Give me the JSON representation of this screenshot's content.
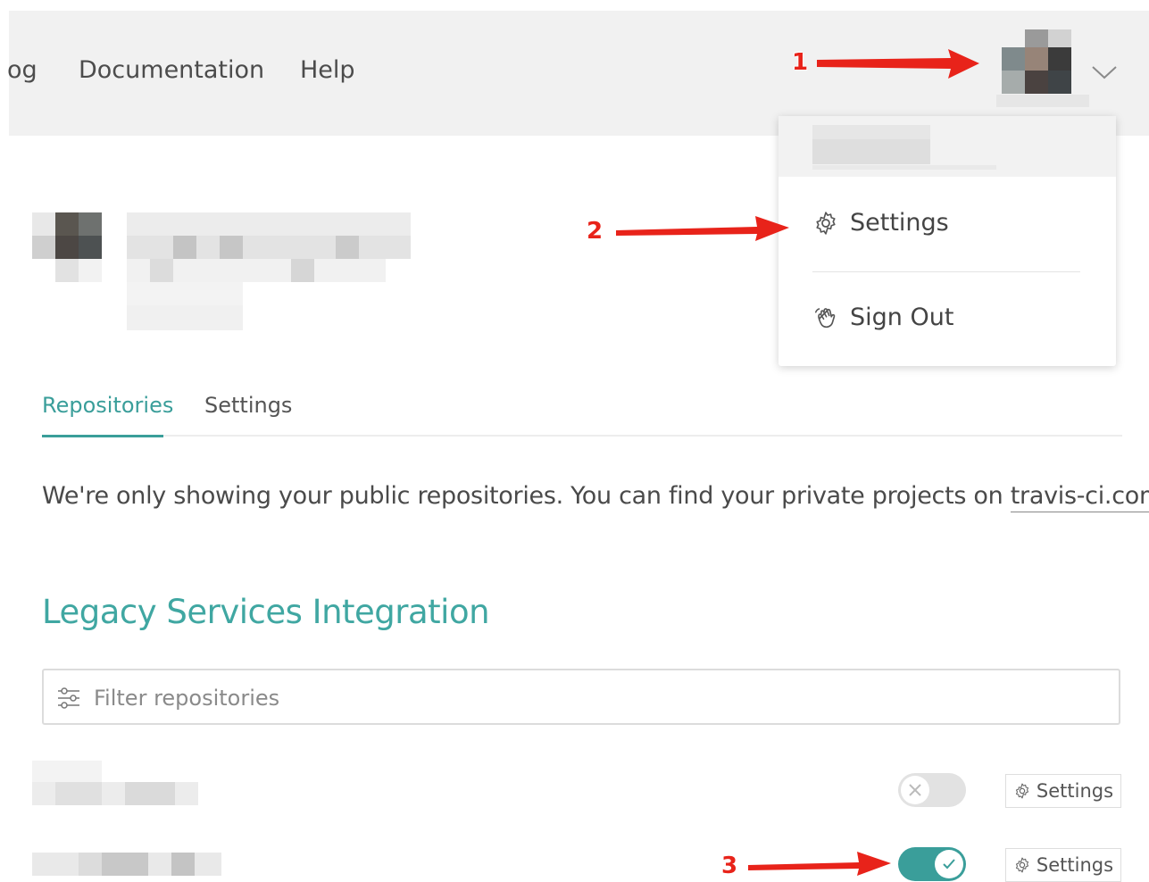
{
  "nav": {
    "items": [
      "og",
      "Documentation",
      "Help"
    ]
  },
  "profile_menu": {
    "settings_label": "Settings",
    "signout_label": "Sign Out"
  },
  "tabs": [
    {
      "label": "Repositories",
      "active": true
    },
    {
      "label": "Settings",
      "active": false
    }
  ],
  "notice": {
    "text": "We're only showing your public repositories. You can find your private projects on",
    "link": "travis-ci.com",
    "suffix": "."
  },
  "section_title": "Legacy Services Integration",
  "filter": {
    "placeholder": "Filter repositories"
  },
  "repos": [
    {
      "enabled": false,
      "settings_label": "Settings"
    },
    {
      "enabled": true,
      "settings_label": "Settings"
    }
  ],
  "annotations": [
    "1",
    "2",
    "3"
  ],
  "colors": {
    "accent": "#3a9e9a",
    "annotation": "#e8231a"
  }
}
